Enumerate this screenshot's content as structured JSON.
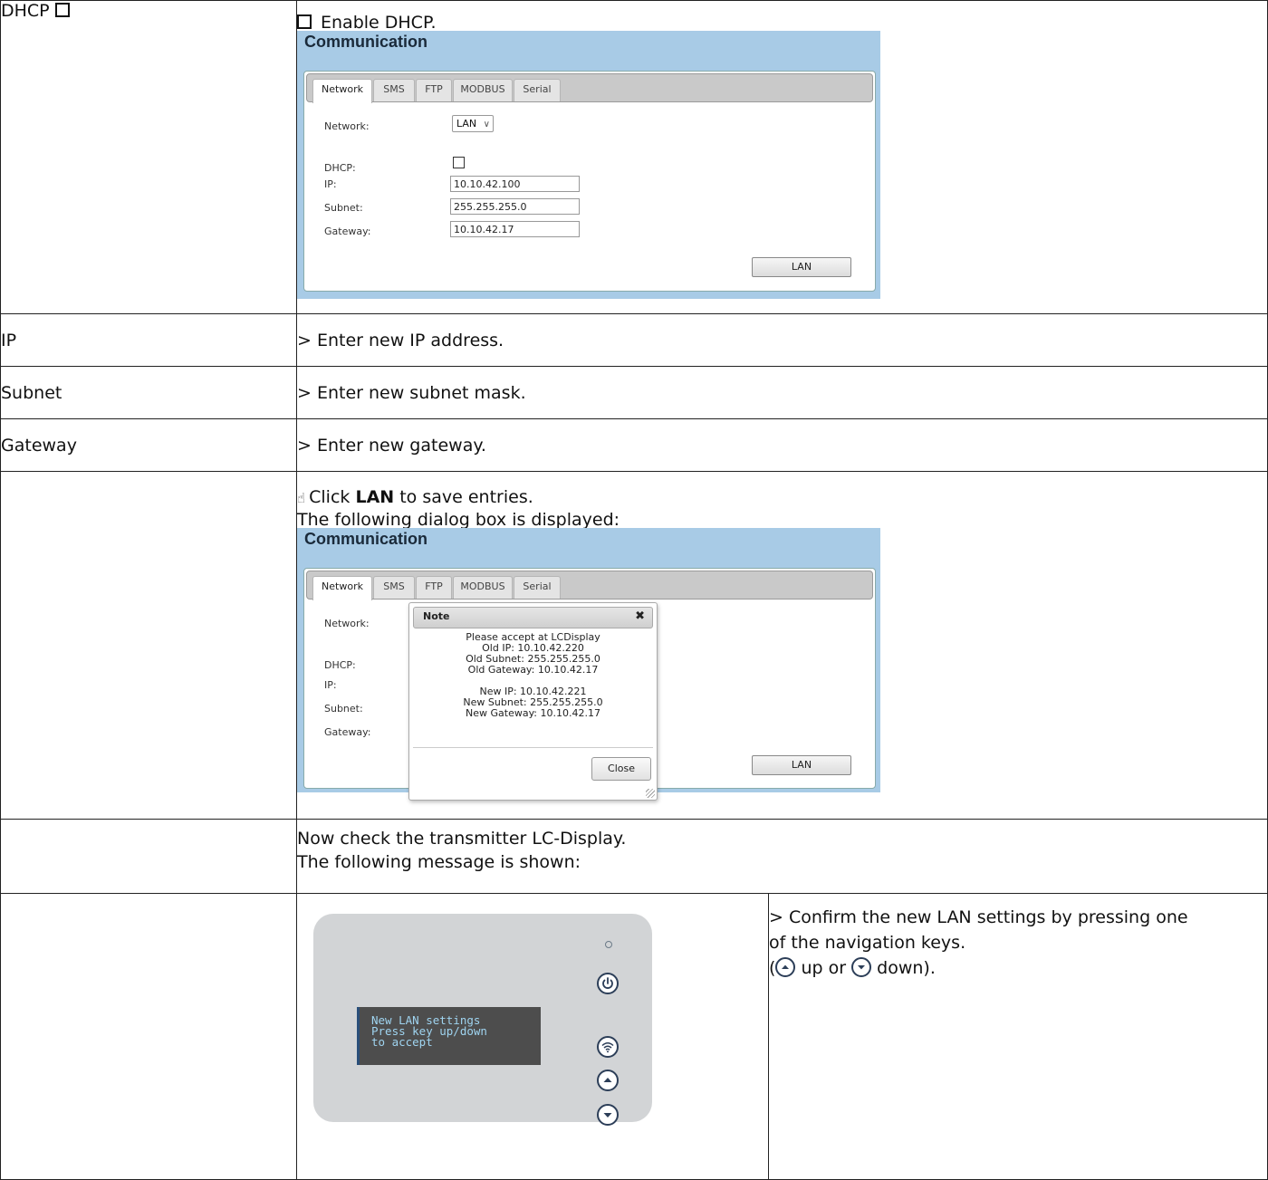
{
  "rows": {
    "dhcp": {
      "label": "DHCP",
      "instruction": "Enable DHCP."
    },
    "ip": {
      "label": "IP",
      "instruction": "> Enter new IP address."
    },
    "subnet": {
      "label": "Subnet",
      "instruction": "> Enter new subnet mask."
    },
    "gateway": {
      "label": "Gateway",
      "instruction": "> Enter new gateway."
    },
    "save": {
      "pre": "Click ",
      "bold": "LAN",
      "post": " to save entries.",
      "line2": "The following dialog box is displayed:"
    },
    "check": {
      "line1": "Now check the transmitter LC-Display.",
      "line2": "The following message is shown:"
    },
    "confirm": {
      "line1": "> Confirm the new LAN settings by pressing one",
      "line2": "of the navigation keys.",
      "up": "up or",
      "down": "down)."
    }
  },
  "comm": {
    "title": "Communication",
    "tabs": [
      "Network",
      "SMS",
      "FTP",
      "MODBUS",
      "Serial"
    ],
    "labels": {
      "network": "Network:",
      "dhcp": "DHCP:",
      "ip": "IP:",
      "subnet": "Subnet:",
      "gateway": "Gateway:"
    },
    "network_value": "LAN",
    "ip_value": "10.10.42.100",
    "subnet_value": "255.255.255.0",
    "gateway_value": "10.10.42.17",
    "lan_button": "LAN"
  },
  "note": {
    "title": "Note",
    "close_glyph": "✖",
    "lines": [
      "Please accept at LCDisplay",
      "Old IP: 10.10.42.220",
      "Old Subnet: 255.255.255.0",
      "Old Gateway: 10.10.42.17",
      "",
      "New IP: 10.10.42.221",
      "New Subnet: 255.255.255.0",
      "New Gateway: 10.10.42.17"
    ],
    "close_button": "Close"
  },
  "device": {
    "lcd": "New LAN settings\nPress key up/down\nto accept",
    "icons": [
      "power-icon",
      "wifi-icon",
      "up-arrow-icon",
      "down-arrow-icon"
    ]
  }
}
